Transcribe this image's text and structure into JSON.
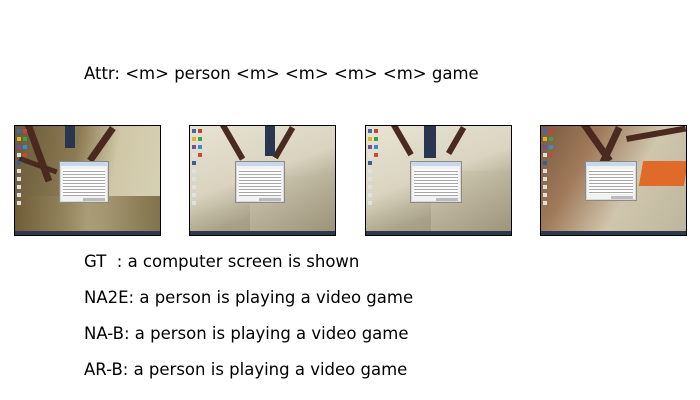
{
  "attr_line": "Attr: <m> person <m> <m> <m> <m> game",
  "captions": {
    "gt": "GT  : a computer screen is shown",
    "na2e": "NA2E: a person is playing a video game",
    "nab": "NA-B: a person is playing a video game",
    "arb": "AR-B: a person is playing a video game"
  },
  "colors": {
    "background": "#ffffff",
    "text": "#000000",
    "frame_border": "#000000"
  }
}
